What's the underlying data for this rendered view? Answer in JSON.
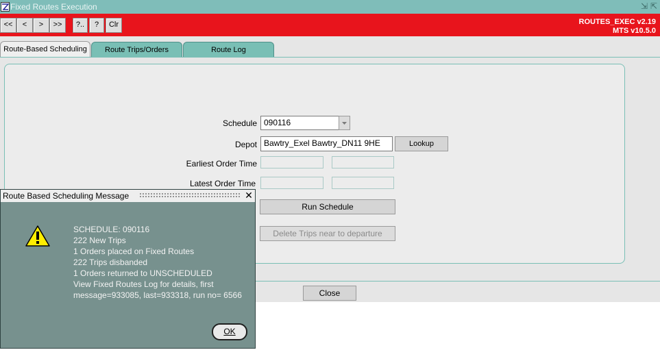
{
  "window": {
    "title": "Fixed Routes Execution",
    "minimize_glyph": "⇲",
    "maximize_glyph": "⇱"
  },
  "toolbar": {
    "buttons": [
      "<<",
      "<",
      ">",
      ">>",
      "?..",
      "?",
      "Clr"
    ],
    "version_line1": "ROUTES_EXEC v2.19",
    "version_line2": "MTS v10.5.0",
    "color": "#e8141c"
  },
  "tabs": [
    "Route-Based Scheduling",
    "Route Trips/Orders",
    "Route Log"
  ],
  "form": {
    "schedule_label": "Schedule",
    "schedule_value": "090116",
    "depot_label": "Depot",
    "depot_value": "Bawtry_Exel Bawtry_DN11 9HE",
    "lookup_label": "Lookup",
    "earliest_label": "Earliest Order Time",
    "latest_label": "Latest Order Time",
    "run_schedule_label": "Run Schedule",
    "delete_trips_label": "Delete Trips near to departure",
    "close_label": "Close"
  },
  "dialog": {
    "title": "Route Based Scheduling Message",
    "close_glyph": "✕",
    "icon": "warning-icon",
    "lines": [
      "SCHEDULE: 090116",
      "222 New Trips",
      "1 Orders placed on Fixed Routes",
      "222 Trips disbanded",
      "1 Orders returned to UNSCHEDULED",
      "View Fixed Routes Log for details, first",
      "message=933085, last=933318, run no= 6566"
    ],
    "ok_label": "OK"
  }
}
